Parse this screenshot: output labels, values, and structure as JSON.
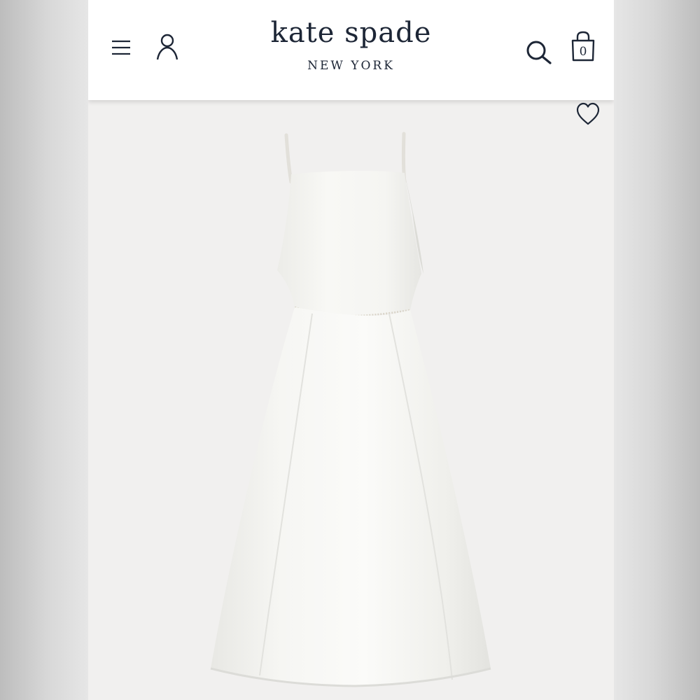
{
  "header": {
    "brand_name": "kate spade",
    "brand_subtitle": "NEW YORK",
    "cart_count": "0",
    "icons": {
      "menu": "hamburger-menu-icon",
      "account": "user-icon",
      "search": "search-icon",
      "bag": "shopping-bag-icon"
    }
  },
  "product": {
    "image": "white-sleeveless-midi-dress",
    "wishlist_icon": "heart-outline-icon"
  },
  "colors": {
    "brand_navy": "#1d2636",
    "page_background": "#f1f0ef",
    "header_background": "#ffffff"
  }
}
